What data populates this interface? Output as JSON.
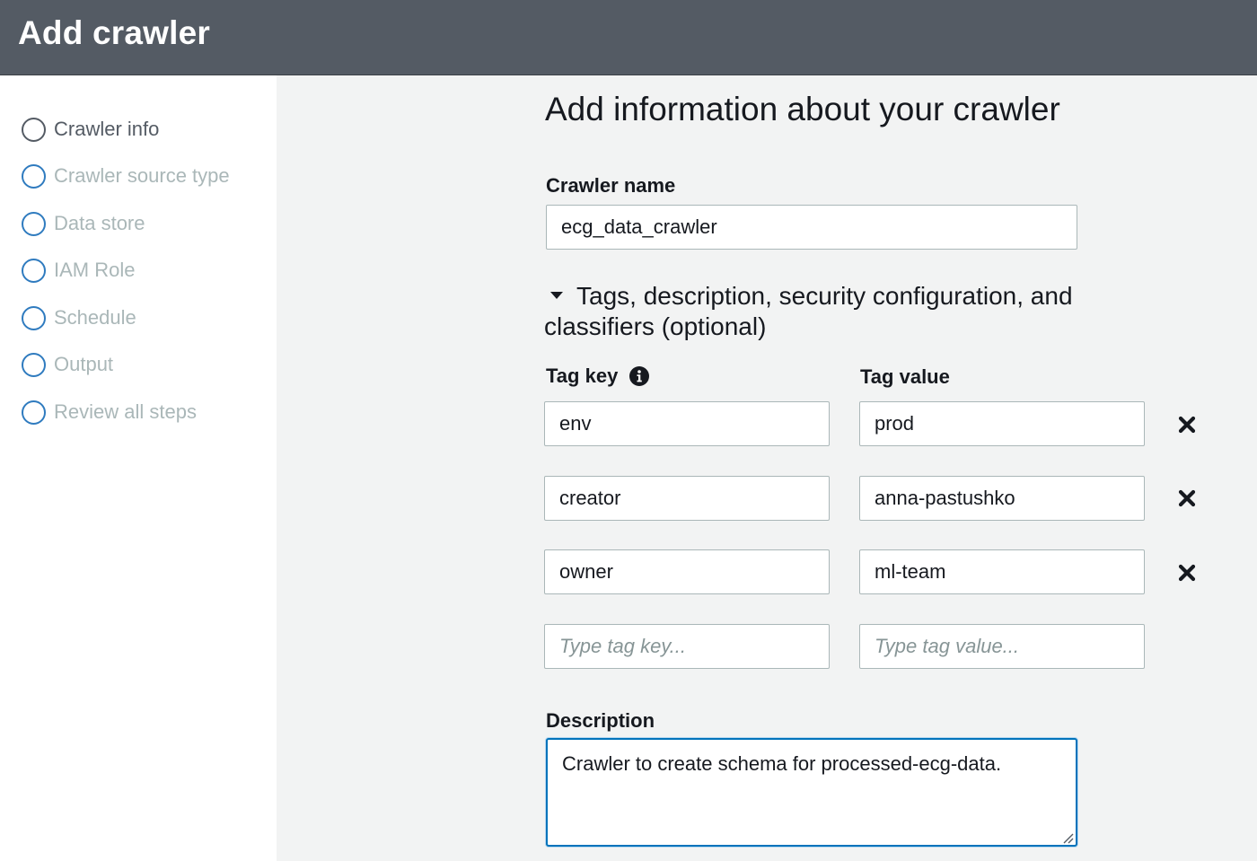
{
  "header": {
    "title": "Add crawler"
  },
  "sidebar": {
    "steps": [
      {
        "label": "Crawler info",
        "active": true
      },
      {
        "label": "Crawler source type",
        "active": false
      },
      {
        "label": "Data store",
        "active": false
      },
      {
        "label": "IAM Role",
        "active": false
      },
      {
        "label": "Schedule",
        "active": false
      },
      {
        "label": "Output",
        "active": false
      },
      {
        "label": "Review all steps",
        "active": false
      }
    ]
  },
  "main": {
    "title": "Add information about your crawler",
    "crawler_name": {
      "label": "Crawler name",
      "value": "ecg_data_crawler"
    },
    "optional_section": {
      "label": "Tags, description, security configuration, and classifiers (optional)",
      "expanded": true
    },
    "tags": {
      "key_header": "Tag key",
      "value_header": "Tag value",
      "rows": [
        {
          "key": "env",
          "value": "prod"
        },
        {
          "key": "creator",
          "value": "anna-pastushko"
        },
        {
          "key": "owner",
          "value": "ml-team"
        }
      ],
      "new_row": {
        "key_placeholder": "Type tag key...",
        "value_placeholder": "Type tag value..."
      }
    },
    "description": {
      "label": "Description",
      "value": "Crawler to create schema for processed-ecg-data."
    }
  },
  "colors": {
    "header_bg": "#545b64",
    "main_bg": "#f2f3f3",
    "step_circle": "#2f7bbf",
    "focus_border": "#0073bb",
    "disabled_text": "#aab7b8"
  },
  "icons": [
    "info-icon",
    "remove-tag-icon",
    "caret-down-icon",
    "step-circle-icon",
    "resize-grip-icon"
  ]
}
